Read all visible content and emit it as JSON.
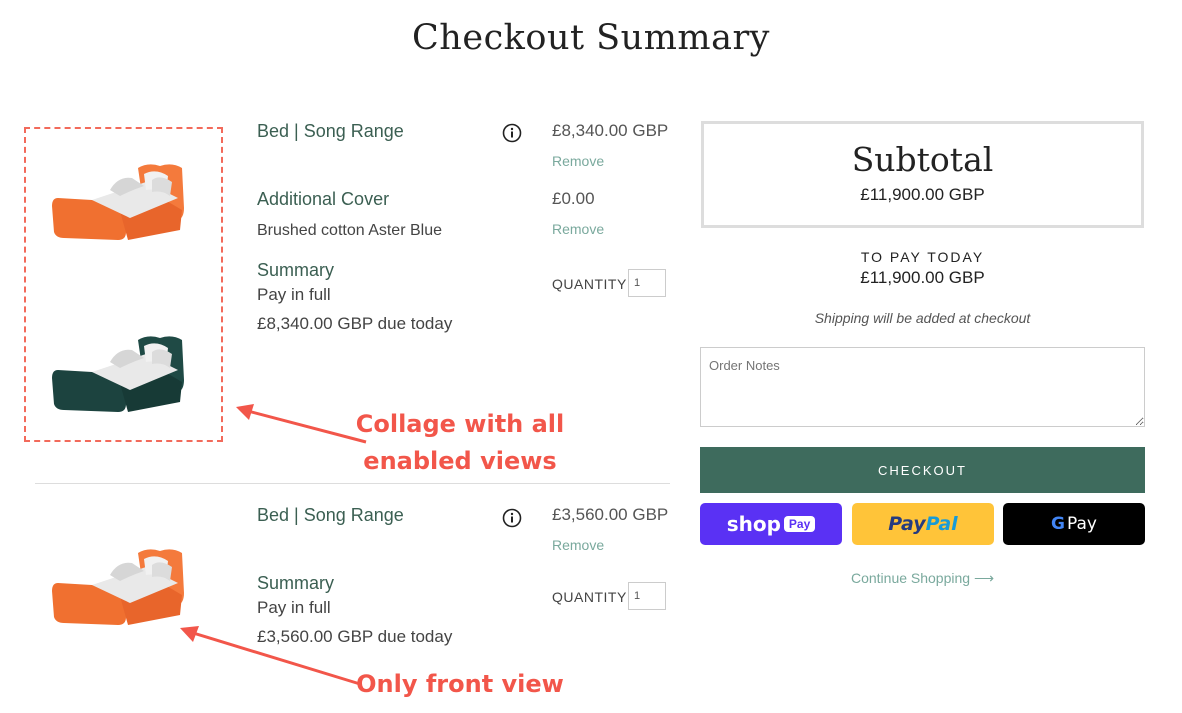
{
  "page_title": "Checkout Summary",
  "items": [
    {
      "name": "Bed | Song Range",
      "price": "£8,340.00 GBP",
      "remove_label": "Remove",
      "cover_title": "Additional Cover",
      "cover_desc": "Brushed cotton Aster Blue",
      "cover_price": "£0.00",
      "cover_remove_label": "Remove",
      "summary_title": "Summary",
      "summary_line1": "Pay in full",
      "summary_line2": "£8,340.00 GBP due today",
      "quantity_label": "QUANTITY",
      "quantity": "1"
    },
    {
      "name": "Bed | Song Range",
      "price": "£3,560.00 GBP",
      "remove_label": "Remove",
      "summary_title": "Summary",
      "summary_line1": "Pay in full",
      "summary_line2": "£3,560.00 GBP due today",
      "quantity_label": "QUANTITY",
      "quantity": "1"
    }
  ],
  "annotations": {
    "collage_line1": "Collage with all",
    "collage_line2": "enabled views",
    "front_view": "Only front view"
  },
  "subtotal": {
    "title": "Subtotal",
    "value": "£11,900.00 GBP"
  },
  "to_pay": {
    "label": "TO PAY TODAY",
    "value": "£11,900.00 GBP"
  },
  "shipping_note": "Shipping will be added at checkout",
  "order_notes_placeholder": "Order Notes",
  "checkout_label": "CHECKOUT",
  "payments": {
    "shop_label": "shop",
    "shop_pay": "Pay",
    "paypal_pay": "Pay",
    "paypal_pal": "Pal",
    "gpay_g": "G",
    "gpay_pay": "Pay"
  },
  "continue_shopping": "Continue Shopping ⟶",
  "colors": {
    "accent_green": "#3e6b5d",
    "link_teal": "#7aa99d",
    "annotation_red": "#f2564a",
    "bed_orange": "#f47a3c",
    "bed_green": "#1f4a45",
    "shop_purple": "#5a31f4",
    "paypal_yellow": "#ffc439"
  }
}
